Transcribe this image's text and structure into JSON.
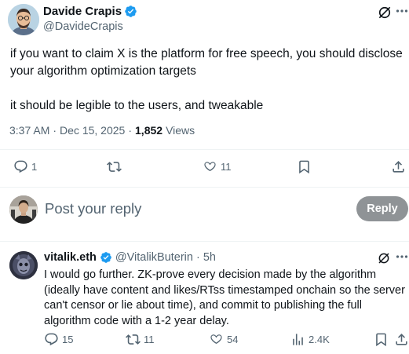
{
  "tweet": {
    "author_name": "Davide Crapis",
    "author_handle": "@DavideCrapis",
    "paragraph1": "if you want to claim X is the platform for free speech, you should disclose your algorithm optimization targets",
    "paragraph2": "it should be legible to the users, and tweakable",
    "time": "3:37 AM",
    "date": "Dec 15, 2025",
    "views_count": "1,852",
    "views_label": "Views",
    "separator": "·"
  },
  "actions": {
    "replies": "1",
    "reposts": "",
    "likes": "11"
  },
  "composer": {
    "placeholder": "Post your reply",
    "reply_button": "Reply"
  },
  "reply": {
    "author_name": "vitalik.eth",
    "author_handle": "@VitalikButerin",
    "separator": "·",
    "time": "5h",
    "text": "I would go further. ZK-prove every decision made by the algorithm (ideally have content and likes/RTss timestamped onchain so the server can't censor or lie about time), and commit to publishing the full algorithm code with a 1-2 year delay.",
    "replies": "15",
    "reposts": "11",
    "likes": "54",
    "views": "2.4K"
  },
  "icons": {
    "verified": "verified-badge-icon",
    "grok": "grok-icon",
    "more": "more-dots-icon",
    "reply": "reply-icon",
    "repost": "repost-icon",
    "like": "heart-icon",
    "bookmark": "bookmark-icon",
    "share": "share-icon",
    "views": "views-icon"
  },
  "colors": {
    "verified": "#1d9bf0",
    "text": "#0f1419",
    "secondary": "#536471",
    "divider": "#eff3f4",
    "reply_button": "#8f9396"
  }
}
